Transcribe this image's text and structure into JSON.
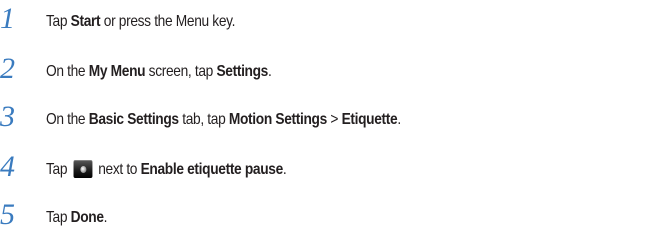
{
  "steps": [
    {
      "number": "1",
      "parts": [
        {
          "t": "Tap ",
          "b": false
        },
        {
          "t": "Start",
          "b": true
        },
        {
          "t": " or press the Menu key.",
          "b": false
        }
      ]
    },
    {
      "number": "2",
      "parts": [
        {
          "t": "On the ",
          "b": false
        },
        {
          "t": "My Menu",
          "b": true
        },
        {
          "t": " screen, tap ",
          "b": false
        },
        {
          "t": "Settings",
          "b": true
        },
        {
          "t": ".",
          "b": false
        }
      ]
    },
    {
      "number": "3",
      "parts": [
        {
          "t": "On the ",
          "b": false
        },
        {
          "t": "Basic Settings",
          "b": true
        },
        {
          "t": " tab, tap ",
          "b": false
        },
        {
          "t": "Motion Settings",
          "b": true
        },
        {
          "t": " > ",
          "b": false
        },
        {
          "t": "Etiquette",
          "b": true
        },
        {
          "t": ".",
          "b": false
        }
      ]
    },
    {
      "number": "4",
      "parts": [
        {
          "t": "Tap ",
          "b": false
        },
        {
          "t": "",
          "icon": "toggle-switch-icon"
        },
        {
          "t": " next to ",
          "b": false
        },
        {
          "t": "Enable etiquette pause",
          "b": true
        },
        {
          "t": ".",
          "b": false
        }
      ]
    },
    {
      "number": "5",
      "parts": [
        {
          "t": "Tap ",
          "b": false
        },
        {
          "t": "Done",
          "b": true
        },
        {
          "t": ".",
          "b": false
        }
      ]
    }
  ],
  "colors": {
    "step_number": "#3a7bbf",
    "text": "#231f20"
  }
}
